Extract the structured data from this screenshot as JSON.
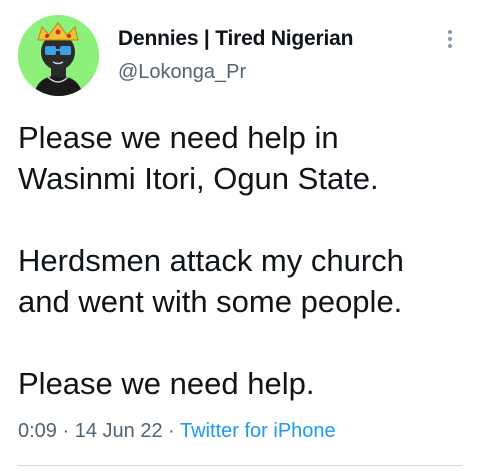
{
  "user": {
    "display_name": "Dennies | Tired Nigerian",
    "handle": "@Lokonga_Pr",
    "avatar_icon": "cartoon-avatar-with-crown"
  },
  "tweet": {
    "lines": [
      "Please we need help in",
      "Wasinmi Itori, Ogun State.",
      "Herdsmen attack my church",
      "and went with some people.",
      "Please we need help."
    ]
  },
  "meta": {
    "time": "0:09",
    "separator": "·",
    "date": "14 Jun 22",
    "source": "Twitter for iPhone"
  },
  "colors": {
    "text": "#0f1419",
    "secondary": "#536471",
    "link": "#1d9bf0",
    "avatar_bg": "#8df07a"
  },
  "icons": {
    "more": "more-vertical-icon"
  }
}
